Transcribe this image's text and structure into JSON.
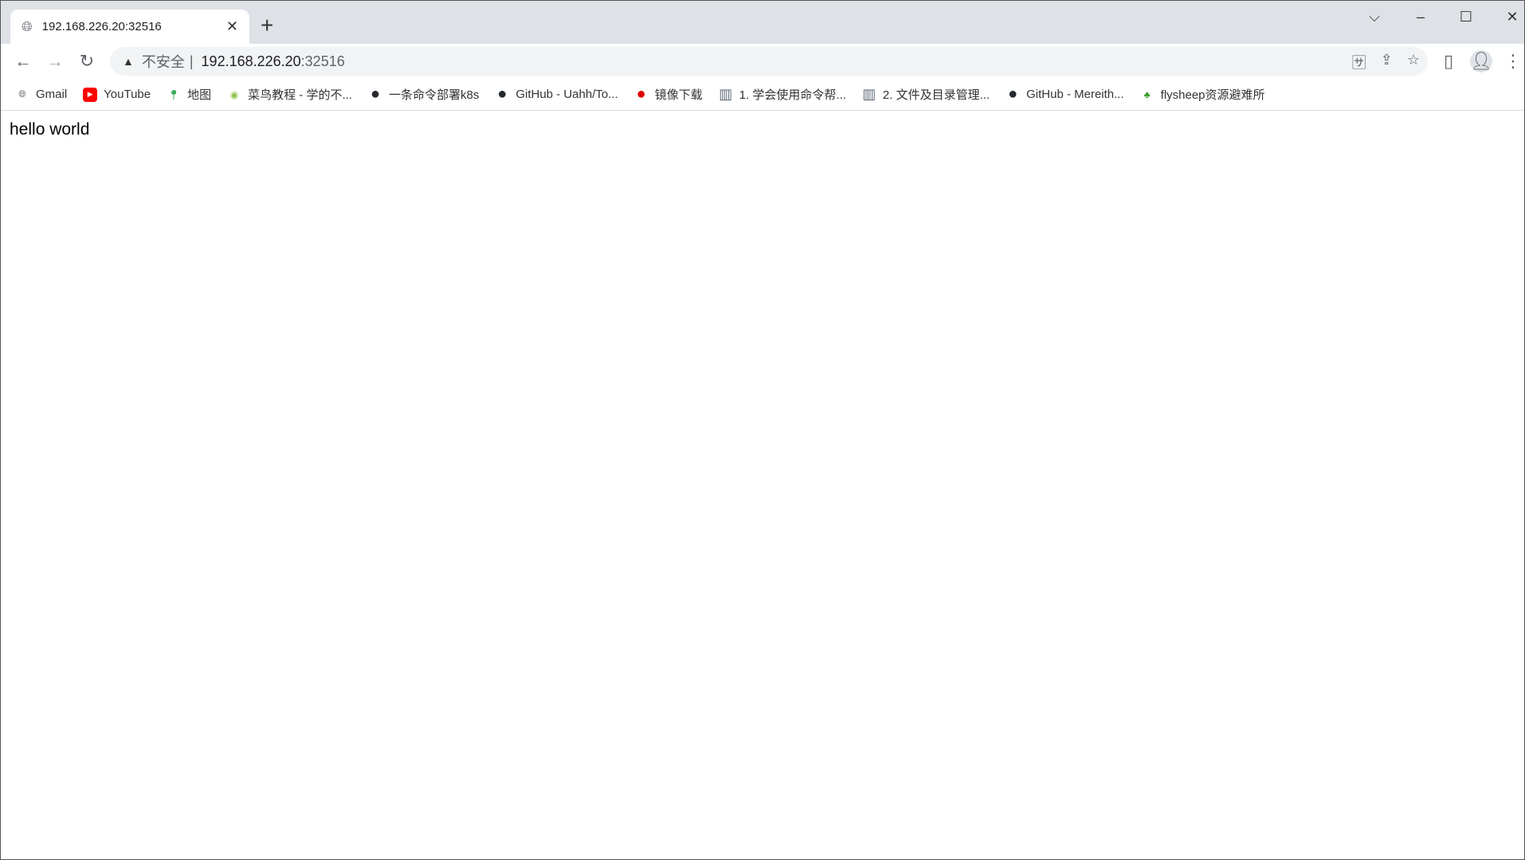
{
  "tab": {
    "title": "192.168.226.20:32516",
    "icon": "globe-icon"
  },
  "window": {
    "dropdown": "⌵",
    "minimize": "–",
    "maximize": "☐",
    "close": "✕"
  },
  "omnibox": {
    "security_label": "不安全",
    "separator": "|",
    "host": "192.168.226.20",
    "port": ":32516"
  },
  "bookmarks": [
    {
      "label": "Gmail",
      "icon": "globe-icon",
      "color": "#5f6368"
    },
    {
      "label": "YouTube",
      "icon": "youtube-icon",
      "color": "#ff0000"
    },
    {
      "label": "地图",
      "icon": "maps-icon",
      "color": "#34a853"
    },
    {
      "label": "菜鸟教程 - 学的不...",
      "icon": "runoob-icon",
      "color": "#8bc34a"
    },
    {
      "label": "一条命令部署k8s",
      "icon": "github-icon",
      "color": "#24292e"
    },
    {
      "label": "GitHub - Uahh/To...",
      "icon": "github-icon",
      "color": "#24292e"
    },
    {
      "label": "镜像下载",
      "icon": "redhat-icon",
      "color": "#e00000"
    },
    {
      "label": "1. 学会使用命令帮...",
      "icon": "book-icon",
      "color": "#5f6b7a"
    },
    {
      "label": "2. 文件及目录管理...",
      "icon": "book-icon",
      "color": "#5f6b7a"
    },
    {
      "label": "GitHub - Mereith...",
      "icon": "github-icon",
      "color": "#24292e"
    },
    {
      "label": "flysheep资源避难所",
      "icon": "tree-icon",
      "color": "#2e9b1e"
    }
  ],
  "page": {
    "text": "hello world"
  }
}
